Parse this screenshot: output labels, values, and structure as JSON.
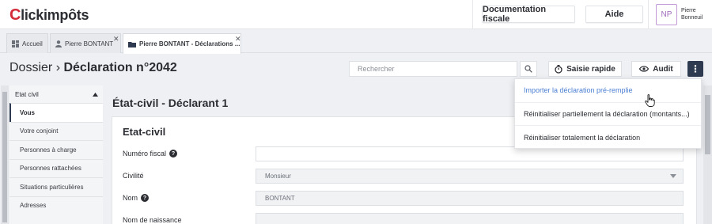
{
  "header": {
    "logo": "Clickimpôts",
    "logo_first": "C",
    "logo_rest": "lickimpôts",
    "doc_button": "Documentation fiscale",
    "help_button": "Aide",
    "avatar_initials": "NP",
    "user_first": "Pierre",
    "user_last": "Bonneuil"
  },
  "tabs": [
    {
      "label": "Accueil",
      "icon": "dashboard-icon"
    },
    {
      "label": "Pierre BONTANT",
      "icon": "person-icon"
    },
    {
      "label": "Pierre BONTANT - Déclarations ...",
      "icon": "folder-icon"
    }
  ],
  "page": {
    "breadcrumb_root": "Dossier",
    "breadcrumb_sep": "›",
    "breadcrumb_current": "Déclaration n°2042",
    "search_placeholder": "Rechercher",
    "quick_entry": "Saisie rapide",
    "audit": "Audit",
    "kebab": "⋮"
  },
  "sidebar": {
    "section": "Etat civil",
    "items": [
      {
        "label": "Vous",
        "active": true
      },
      {
        "label": "Votre conjoint"
      },
      {
        "label": "Personnes à charge"
      },
      {
        "label": "Personnes rattachées"
      },
      {
        "label": "Situations particulières"
      },
      {
        "label": "Adresses"
      }
    ]
  },
  "main": {
    "page_title": "État-civil - Déclarant 1",
    "card_title": "Etat-civil",
    "fields": [
      {
        "label": "Numéro fiscal",
        "help": true,
        "value": ""
      },
      {
        "label": "Civilité",
        "help": false,
        "value": "Monsieur"
      },
      {
        "label": "Nom",
        "help": true,
        "value": "BONTANT"
      },
      {
        "label": "Nom de naissance",
        "help": false,
        "value": ""
      }
    ]
  },
  "menu": {
    "items": [
      "Importer la déclaration pré-remplie",
      "Réinitialiser partiellement la déclaration (montants...)",
      "Réinitialiser totalement la déclaration"
    ]
  },
  "colors": {
    "brand_red": "#d42b3a",
    "dark_navy": "#2e3a4f",
    "link_blue": "#4c7fd3",
    "avatar_purple": "#a06bbd"
  }
}
